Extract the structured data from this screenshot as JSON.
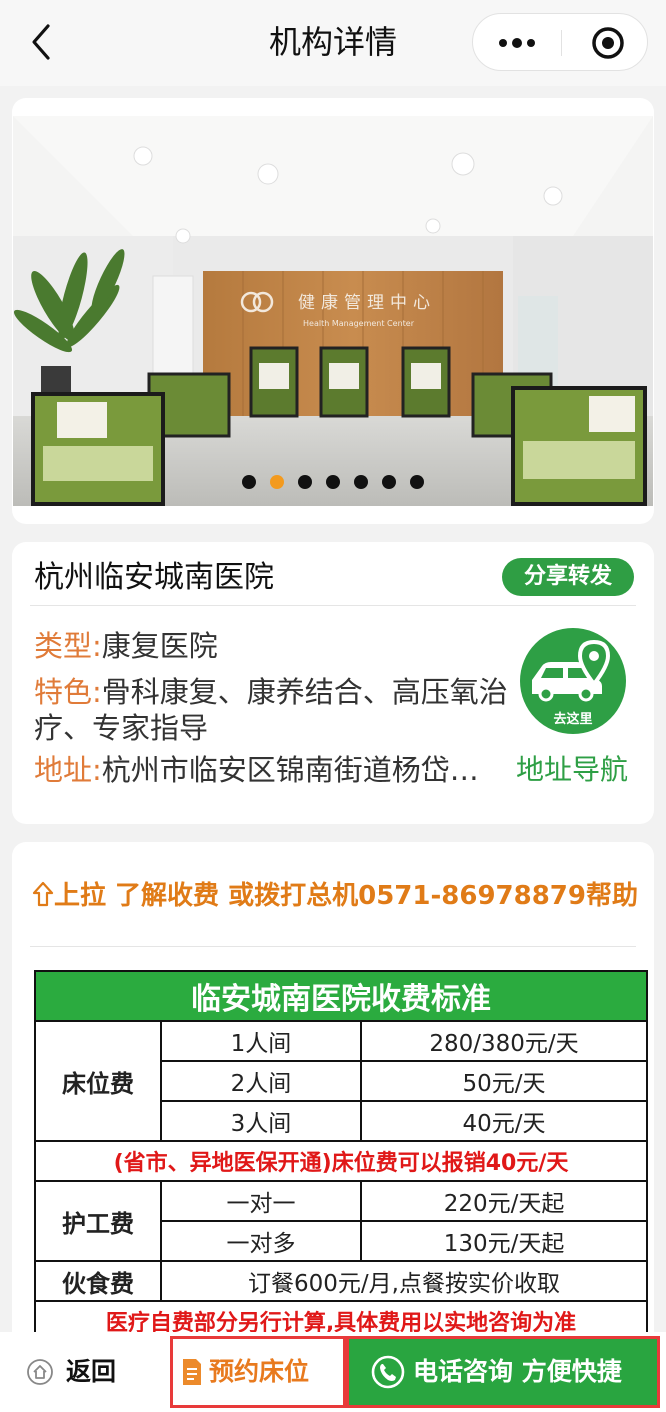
{
  "nav": {
    "title": "机构详情"
  },
  "banner": {
    "photo_sign": "健康管理中心",
    "photo_sign_en": "Health Management Center",
    "active_slide": 2,
    "slide_count": 7
  },
  "info": {
    "name": "杭州临安城南医院",
    "share_label": "分享转发",
    "type_label": "类型:",
    "type_value": "康复医院",
    "feature_label": "特色:",
    "feature_value": "骨科康复、康养结合、高压氧治疗、专家指导",
    "address_label": "地址:",
    "address_value": "杭州市临安区锦南街道杨岱…",
    "goto_label": "去这里",
    "nav_link": "地址导航"
  },
  "fees": {
    "tip": "上拉 了解收费 或拨打总机0571-86978879帮助",
    "table_title": "临安城南医院收费标准",
    "bed_category": "床位费",
    "bed_rows": [
      {
        "room": "1人间",
        "price": "280/380元/天"
      },
      {
        "room": "2人间",
        "price": "50元/天"
      },
      {
        "room": "3人间",
        "price": "40元/天"
      }
    ],
    "insurance_note": "(省市、异地医保开通)床位费可以报销40元/天",
    "care_category": "护工费",
    "care_rows": [
      {
        "type": "一对一",
        "price": "220元/天起"
      },
      {
        "type": "一对多",
        "price": "130元/天起"
      }
    ],
    "meal_category": "伙食费",
    "meal_value": "订餐600元/月,点餐按实价收取",
    "footer_note": "医疗自费部分另行计算,具体费用以实地咨询为准"
  },
  "bottom": {
    "back_label": "返回",
    "reserve_label": "预约床位",
    "call_label": "电话咨询 方便快捷"
  },
  "colors": {
    "accent_green": "#2e9f45",
    "label_orange": "#e07b39",
    "alert_red": "#e01818",
    "dot_active": "#f39a1e"
  }
}
